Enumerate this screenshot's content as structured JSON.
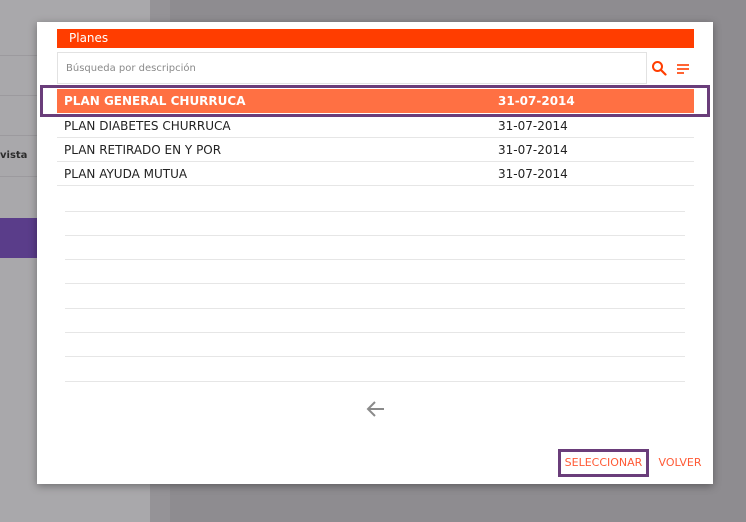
{
  "dialog": {
    "title": "Planes",
    "search": {
      "placeholder": "Búsqueda por descripción",
      "value": ""
    },
    "rows": [
      {
        "description": "PLAN GENERAL CHURRUCA",
        "date": "31-07-2014",
        "selected": true
      },
      {
        "description": "PLAN DIABETES CHURRUCA",
        "date": "31-07-2014",
        "selected": false
      },
      {
        "description": "PLAN RETIRADO EN Y POR",
        "date": "31-07-2014",
        "selected": false
      },
      {
        "description": "PLAN AYUDA MUTUA",
        "date": "31-07-2014",
        "selected": false
      }
    ],
    "buttons": {
      "select_label": "SELECCIONAR",
      "back_label": "VOLVER"
    }
  },
  "background": {
    "partial_label": "vista"
  },
  "colors": {
    "header": "#ff3d00",
    "selected_row": "#ff7043",
    "highlight_frame": "#6a3d7a",
    "button_text": "#ff5a36"
  },
  "icons": {
    "search": "search-icon",
    "filter": "filter-lines-icon",
    "back": "arrow-left-icon"
  }
}
